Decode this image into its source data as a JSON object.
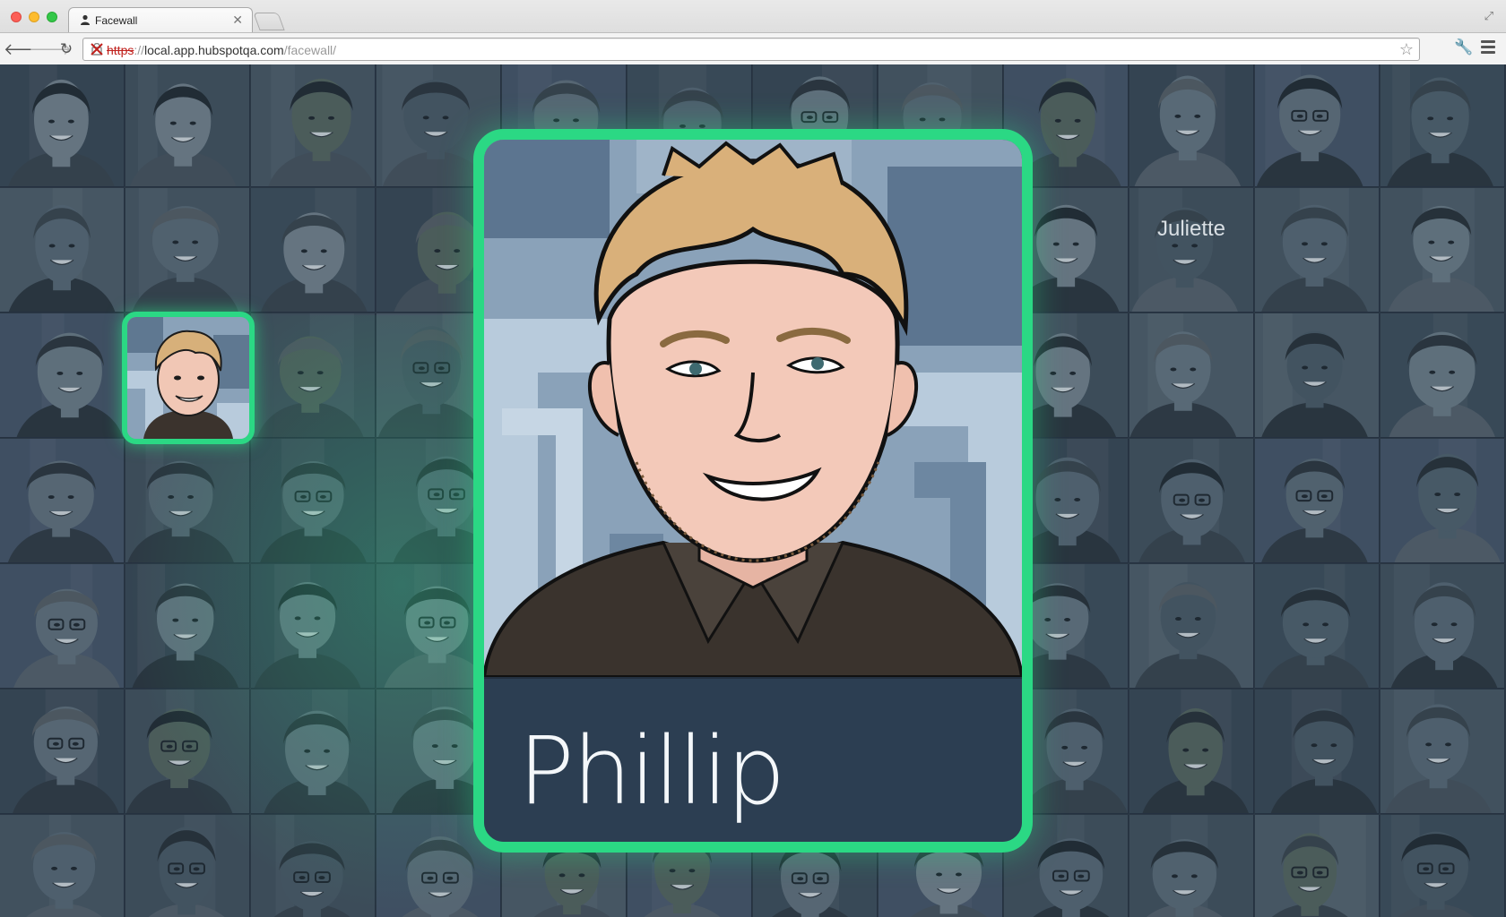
{
  "window": {
    "tab_title": "Facewall",
    "url_scheme": "https",
    "url_separator": "://",
    "url_host": "local.app.hubspotqa.com",
    "url_path": "/facewall/"
  },
  "wall": {
    "featured": {
      "name": "Phillip"
    },
    "overlay_name": "Juliette"
  },
  "colors": {
    "highlight": "#2bd884",
    "wall_background": "#2b3845",
    "name_bar": "#2c3e52"
  }
}
